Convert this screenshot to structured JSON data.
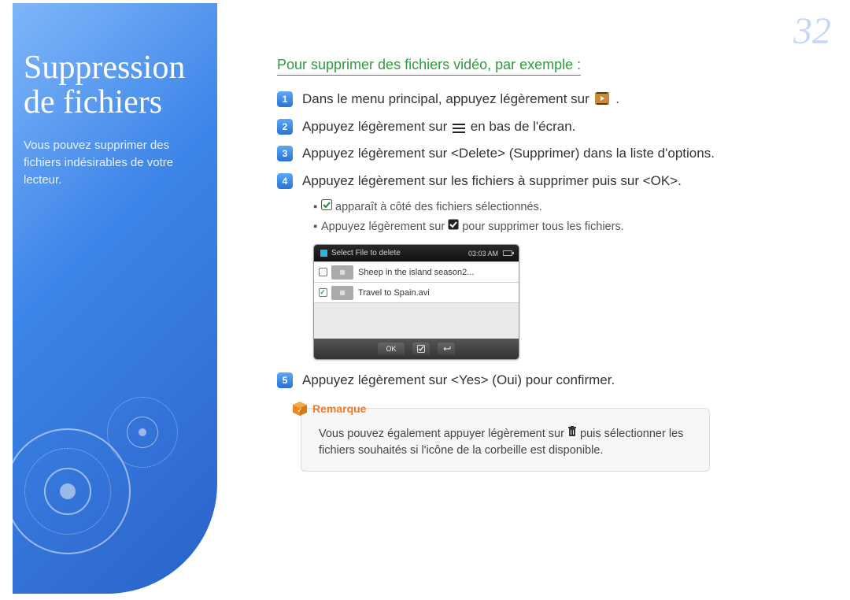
{
  "page_number": "32",
  "sidebar": {
    "title_line1": "Suppression",
    "title_line2": "de fichiers",
    "desc": "Vous pouvez supprimer des fichiers indésirables de votre lecteur."
  },
  "section_title": "Pour supprimer des fichiers vidéo, par exemple :",
  "steps": {
    "s1_a": "Dans le menu principal, appuyez légèrement sur ",
    "s1_b": ".",
    "s2_a": "Appuyez légèrement sur ",
    "s2_b": " en bas de l'écran.",
    "s3": "Appuyez légèrement sur <Delete> (Supprimer) dans la liste d'options.",
    "s4": "Appuyez légèrement sur les fichiers à supprimer puis sur <OK>.",
    "s5": "Appuyez légèrement sur <Yes> (Oui) pour confirmer."
  },
  "sub": {
    "a1": " apparaît à côté des fichiers sélectionnés.",
    "b1": "Appuyez légèrement sur ",
    "b2": " pour supprimer tous les fichiers."
  },
  "mock": {
    "title": "Select File to delete",
    "time": "03:03 AM",
    "row1": "Sheep in the island season2...",
    "row2": "Travel to Spain.avi",
    "ok": "OK"
  },
  "note": {
    "label": "Remarque",
    "text_a": "Vous pouvez également appuyer légèrement sur ",
    "text_b": " puis sélectionner les fichiers souhaités si l'icône de la corbeille est disponible."
  }
}
